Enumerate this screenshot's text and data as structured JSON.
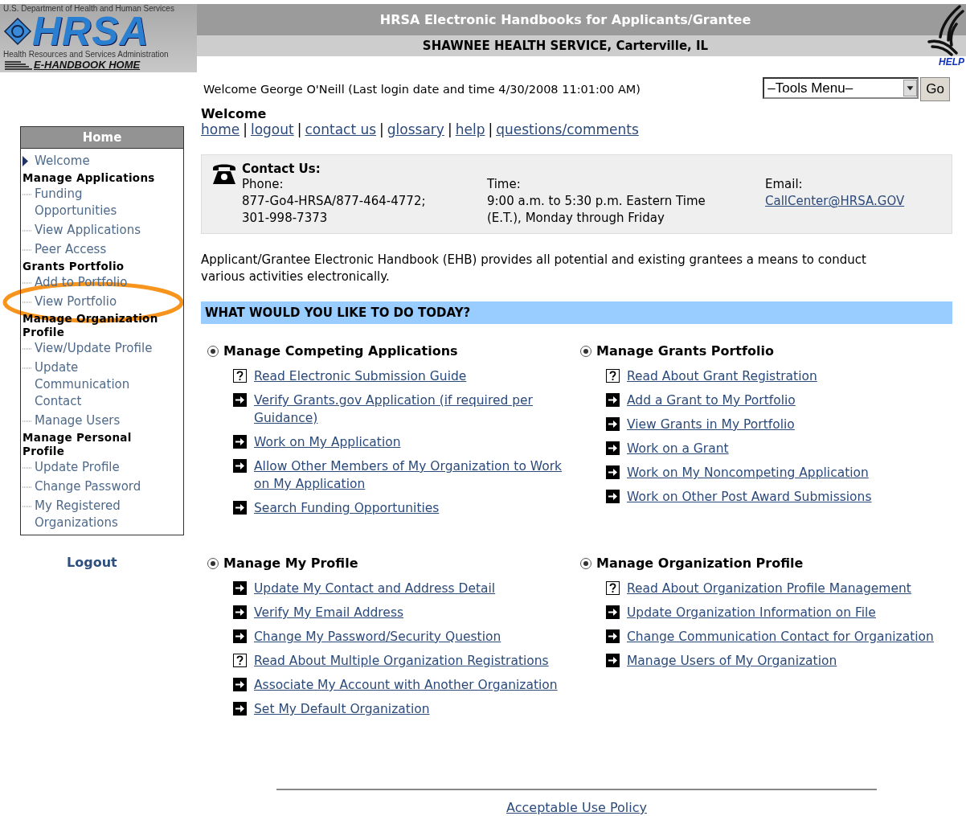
{
  "header": {
    "agency": "U.S. Department of Health and Human Services",
    "logo_text": "HRSA",
    "agency_full": "Health Resources and Services Administration",
    "home_link": "E-HANDBOOK HOME",
    "title": "HRSA Electronic Handbooks for Applicants/Grantee",
    "organization": "SHAWNEE HEALTH SERVICE, Carterville, IL",
    "help": "HELP"
  },
  "welcome_line": "Welcome George O'Neill (Last login date and time 4/30/2008 11:01:00 AM)",
  "tools_menu": {
    "value": "–Tools Menu–",
    "go": "Go"
  },
  "page_title": "Welcome",
  "top_links": [
    "home ",
    "logout ",
    "contact us ",
    "glossary ",
    "help ",
    "questions/comments"
  ],
  "link_separator": "|",
  "contact": {
    "title": "Contact Us:",
    "columns": [
      {
        "label": "Phone:",
        "lines": [
          "877-Go4-HRSA/877-464-4772;",
          "301-998-7373"
        ]
      },
      {
        "label": "Time:",
        "lines": [
          "9:00 a.m. to 5:30 p.m. Eastern Time",
          "(E.T.), Monday through Friday"
        ]
      },
      {
        "label": "Email:",
        "link": "CallCenter@HRSA.GOV"
      }
    ]
  },
  "intro": "Applicant/Grantee Electronic Handbook (EHB) provides all potential and existing grantees a means to conduct various activities electronically.",
  "tasks": {
    "heading": "WHAT WOULD YOU LIKE TO DO TODAY?",
    "sections": [
      {
        "title": "Manage Competing Applications",
        "selected": true,
        "links": [
          {
            "kind": "help",
            "label": "Read Electronic Submission Guide"
          },
          {
            "kind": "arrow",
            "label": "Verify Grants.gov Application (if required per Guidance)"
          },
          {
            "kind": "arrow",
            "label": "Work on My Application"
          },
          {
            "kind": "arrow",
            "label": "Allow Other Members of My Organization to Work on My Application"
          },
          {
            "kind": "arrow",
            "label": "Search Funding Opportunities"
          }
        ]
      },
      {
        "title": "Manage Grants Portfolio",
        "selected": true,
        "links": [
          {
            "kind": "help",
            "label": "Read About Grant Registration"
          },
          {
            "kind": "arrow",
            "label": "Add a Grant to My Portfolio"
          },
          {
            "kind": "arrow",
            "label": "View Grants in My Portfolio"
          },
          {
            "kind": "arrow",
            "label": "Work on a Grant"
          },
          {
            "kind": "arrow",
            "label": "Work on My Noncompeting Application"
          },
          {
            "kind": "arrow",
            "label": "Work on Other Post Award Submissions"
          }
        ]
      },
      {
        "title": "Manage My Profile",
        "selected": true,
        "links": [
          {
            "kind": "arrow",
            "label": "Update My Contact and Address Detail"
          },
          {
            "kind": "arrow",
            "label": "Verify My Email Address"
          },
          {
            "kind": "arrow",
            "label": "Change My Password/Security Question"
          },
          {
            "kind": "help",
            "label": "Read About Multiple Organization Registrations"
          },
          {
            "kind": "arrow",
            "label": "Associate My Account with Another Organization"
          },
          {
            "kind": "arrow",
            "label": "Set My Default Organization"
          }
        ]
      },
      {
        "title": "Manage Organization Profile",
        "selected": true,
        "links": [
          {
            "kind": "help",
            "label": "Read About Organization Profile Management"
          },
          {
            "kind": "arrow",
            "label": "Update Organization Information on File"
          },
          {
            "kind": "arrow",
            "label": "Change Communication Contact for Organization"
          },
          {
            "kind": "arrow",
            "label": "Manage Users of My Organization"
          }
        ]
      }
    ]
  },
  "sidebar": {
    "title": "Home",
    "items": [
      {
        "kind": "link",
        "label": "Welcome",
        "selected": true
      },
      {
        "kind": "heading",
        "label": "Manage Applications"
      },
      {
        "kind": "link",
        "label": "Funding Opportunities",
        "selected": false
      },
      {
        "kind": "link",
        "label": "View Applications",
        "selected": false
      },
      {
        "kind": "link",
        "label": "Peer Access",
        "selected": false
      },
      {
        "kind": "heading",
        "label": "Grants Portfolio"
      },
      {
        "kind": "link",
        "label": "Add to Portfolio",
        "selected": false
      },
      {
        "kind": "link",
        "label": "View Portfolio",
        "selected": false,
        "highlighted": true
      },
      {
        "kind": "heading",
        "label": "Manage Organization Profile"
      },
      {
        "kind": "link",
        "label": "View/Update Profile",
        "selected": false
      },
      {
        "kind": "link",
        "label": "Update Communication Contact",
        "selected": false
      },
      {
        "kind": "link",
        "label": "Manage Users",
        "selected": false
      },
      {
        "kind": "heading",
        "label": "Manage Personal Profile"
      },
      {
        "kind": "link",
        "label": "Update Profile",
        "selected": false
      },
      {
        "kind": "link",
        "label": "Change Password",
        "selected": false
      },
      {
        "kind": "link",
        "label": "My Registered Organizations",
        "selected": false
      }
    ]
  },
  "logout": "Logout",
  "footer_link": "Acceptable Use Policy"
}
